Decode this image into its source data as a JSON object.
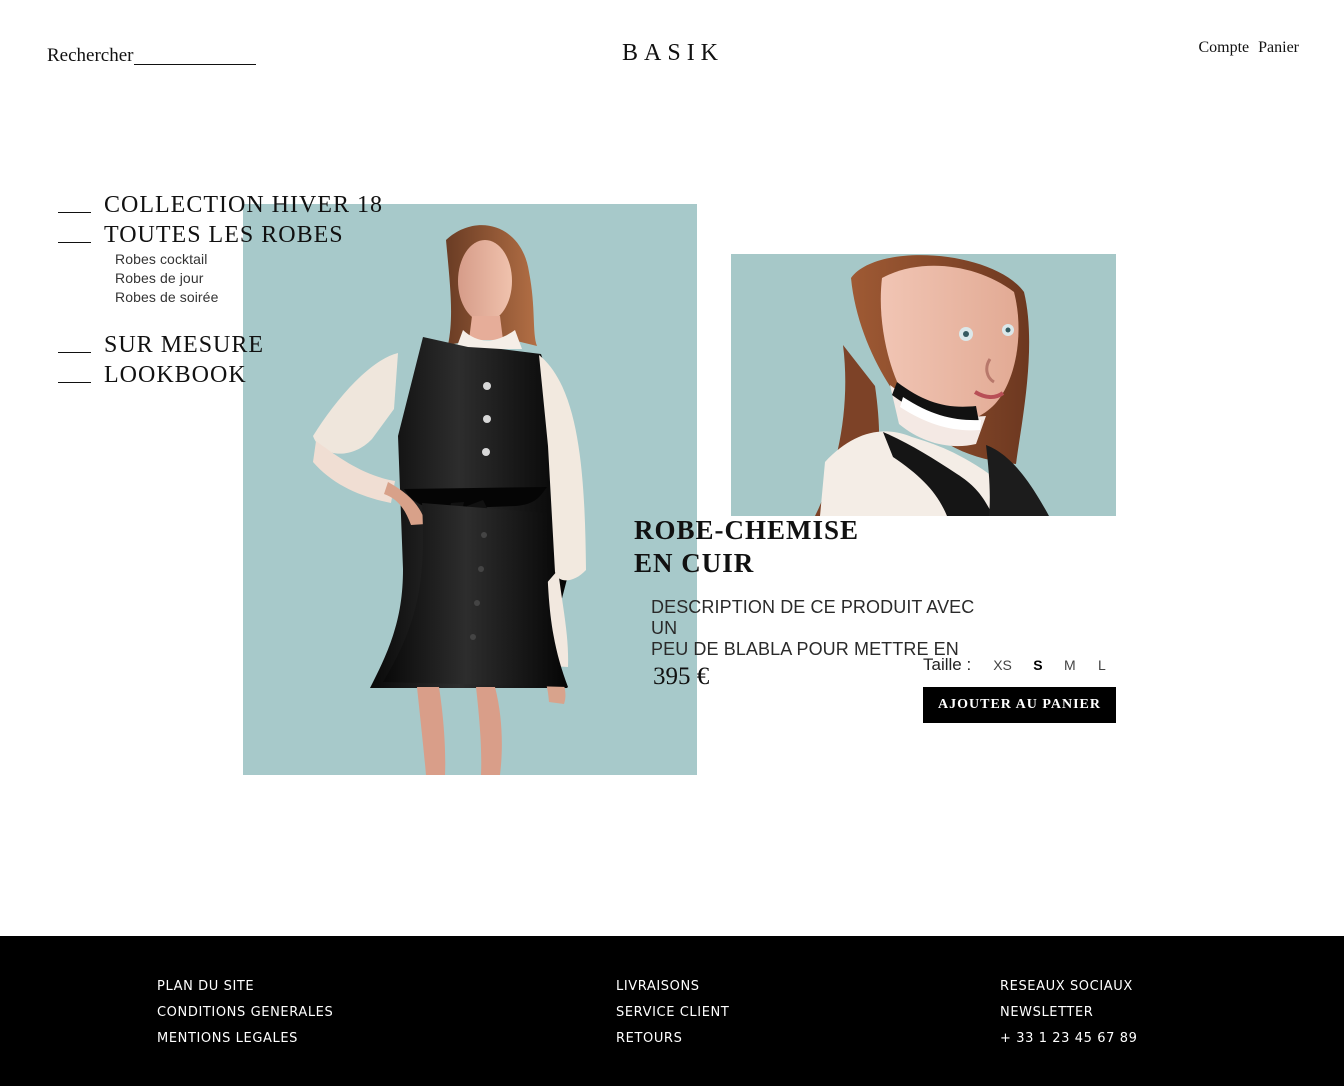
{
  "header": {
    "search_label": "Rechercher",
    "brand": "BASIK",
    "account_label": "Compte",
    "cart_label": "Panier"
  },
  "nav": {
    "collection_label": "COLLECTION HIVER 18",
    "all_dresses_label": "TOUTES LES ROBES",
    "subitems": [
      "Robes cocktail",
      "Robes de jour",
      "Robes de soirée"
    ],
    "custom_label": "SUR MESURE",
    "lookbook_label": "LOOKBOOK"
  },
  "product": {
    "title_line_1": "ROBE-CHEMISE",
    "title_line_2": "EN CUIR",
    "description_line_1": "DESCRIPTION DE CE PRODUIT AVEC UN",
    "description_line_2": "PEU DE BLABLA POUR METTRE EN",
    "price": "395 €",
    "size_label": "Taille :",
    "sizes": [
      "XS",
      "S",
      "M",
      "L"
    ],
    "selected_size": "S",
    "add_to_cart_label": "AJOUTER AU PANIER"
  },
  "footer": {
    "column_1": [
      "PLAN DU SITE",
      "CONDITIONS GENERALES",
      "MENTIONS LEGALES"
    ],
    "column_2": [
      "LIVRAISONS",
      "SERVICE CLIENT",
      "RETOURS"
    ],
    "column_3": [
      "RESEAUX SOCIAUX",
      "NEWSLETTER",
      "+ 33 1 23 45 67 89"
    ]
  },
  "colors": {
    "background": "#ffffff",
    "text": "#111111",
    "footer_background": "#000000",
    "footer_text": "#ffffff",
    "image_background": "#a8c9ca",
    "button_background": "#000000"
  }
}
